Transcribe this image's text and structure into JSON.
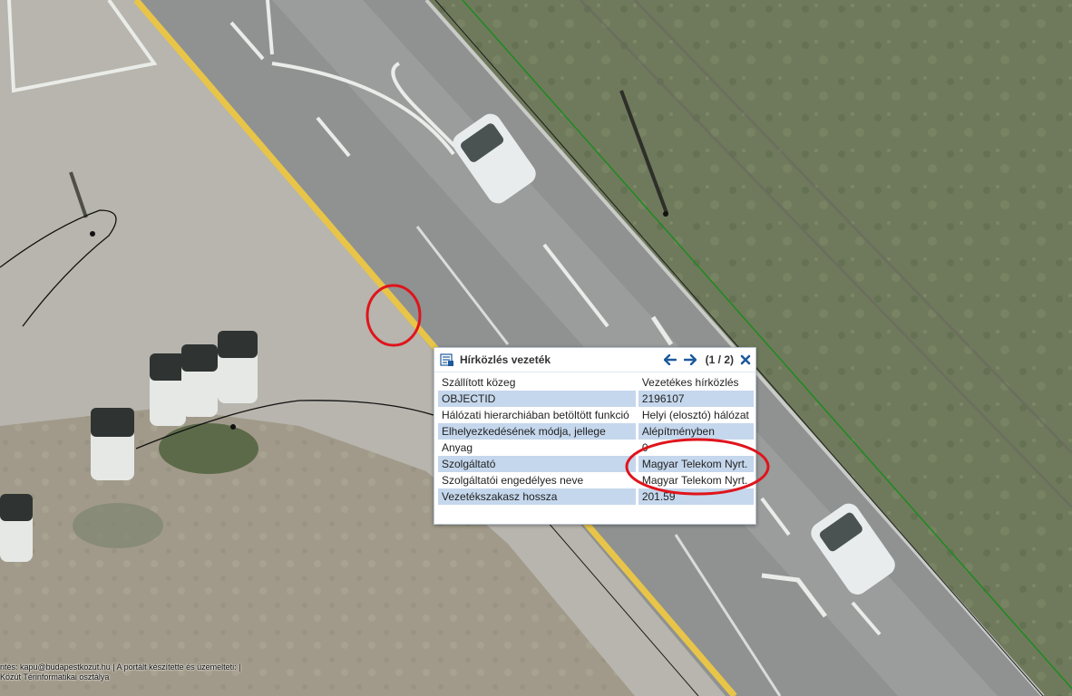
{
  "popup": {
    "title": "Hírközlés vezeték",
    "page_indicator": "(1 / 2)",
    "icons": {
      "layer": "feature-info-icon",
      "prev": "arrow-left-icon",
      "next": "arrow-right-icon",
      "close": "close-icon"
    },
    "accent_color": "#1e5a9c",
    "row_highlight_color": "#c5d7ec",
    "rows": [
      {
        "key": "Szállított közeg",
        "value": "Vezetékes hírközlés"
      },
      {
        "key": "OBJECTID",
        "value": "2196107"
      },
      {
        "key": "Hálózati hierarchiában betöltött funkció",
        "value": "Helyi (elosztó) hálózat"
      },
      {
        "key": "Elhelyezkedésének módja, jellege",
        "value": "Alépítményben"
      },
      {
        "key": "Anyag",
        "value": "0"
      },
      {
        "key": "Szolgáltató",
        "value": "Magyar Telekom Nyrt."
      },
      {
        "key": "Szolgáltatói engedélyes neve",
        "value": "Magyar Telekom Nyrt."
      },
      {
        "key": "Vezetékszakasz hossza",
        "value": "201.59"
      }
    ]
  },
  "credits": {
    "line1": "ntés: kapu@budapestkozut.hu | A portált készítette és üzemelteti: |",
    "line2": "Közút Térinformatikai osztálya"
  },
  "annotation_color": "#e0141c"
}
